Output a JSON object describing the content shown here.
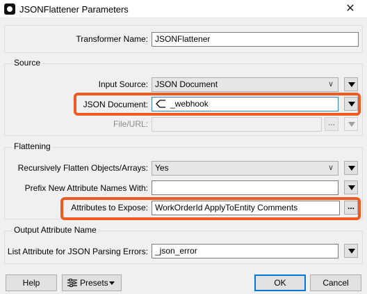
{
  "window": {
    "title": "JSONFlattener Parameters",
    "close_glyph": "✕"
  },
  "transformer": {
    "label": "Transformer Name:",
    "value": "JSONFlattener"
  },
  "source": {
    "group_title": "Source",
    "input_source_label": "Input Source:",
    "input_source_value": "JSON Document",
    "json_document_label": "JSON Document:",
    "json_document_value": "_webhook",
    "json_document_icon": "attribute-icon",
    "file_url_label": "File/URL:",
    "file_url_value": "",
    "browse_glyph": "..."
  },
  "flattening": {
    "group_title": "Flattening",
    "recursive_label": "Recursively Flatten Objects/Arrays:",
    "recursive_value": "Yes",
    "prefix_label": "Prefix New Attribute Names With:",
    "prefix_value": "",
    "expose_label": "Attributes to Expose:",
    "expose_value": "WorkOrderId ApplyToEntity Comments",
    "browse_glyph": "..."
  },
  "output": {
    "group_title": "Output Attribute Name",
    "list_attr_label": "List Attribute for JSON Parsing Errors:",
    "list_attr_value": "_json_error"
  },
  "footer": {
    "help_label": "Help",
    "presets_label": "Presets",
    "ok_label": "OK",
    "cancel_label": "Cancel"
  },
  "colors": {
    "highlight": "#f05a22",
    "focus_border": "#0078d7"
  }
}
